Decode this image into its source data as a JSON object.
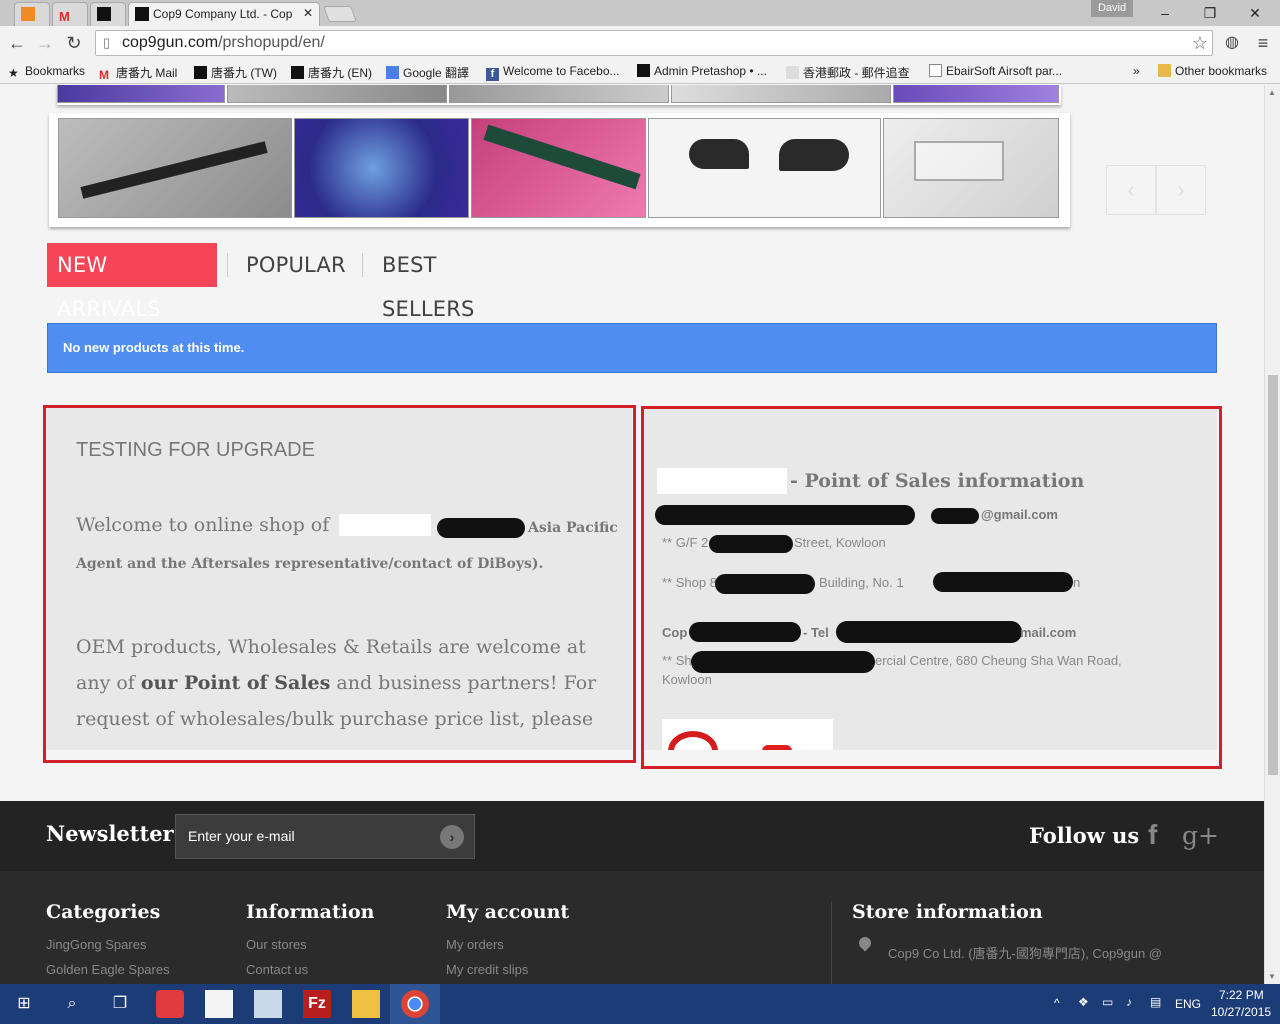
{
  "browser": {
    "tabs": [
      {
        "label": ""
      },
      {
        "label": ""
      },
      {
        "label": ""
      },
      {
        "label": "Cop9 Company Ltd. - Cop"
      }
    ],
    "user": "David",
    "url_host": "cop9gun.com",
    "url_path": "/prshopupd/en/",
    "bookmarks": [
      "Bookmarks",
      "唐番九 Mail",
      "唐番九 (TW)",
      "唐番九 (EN)",
      "Google 翻譯",
      "Welcome to Facebo...",
      "Admin Pretashop • ...",
      "香港郵政 - 郵件追查",
      "EbairSoft Airsoft par...",
      "»",
      "Other bookmarks"
    ]
  },
  "product_tabs": {
    "new_arrivals": "NEW ARRIVALS",
    "popular": "POPULAR",
    "best_sellers": "BEST SELLERS"
  },
  "alert": "No new products at this time.",
  "left_panel": {
    "heading": "TESTING FOR UPGRADE",
    "welcome_prefix": "Welcome to online shop of",
    "welcome_suffix": "Asia Pacific",
    "agent_line": "Agent and the Aftersales representative/contact of DiBoys).",
    "oem_line1": "OEM products, Wholesales & Retails are welcome at",
    "oem_line2a": "any of",
    "oem_bold": "our Point of Sales",
    "oem_line2b": "and business partners! For",
    "oem_line3": "request of wholesales/bulk purchase price list, please"
  },
  "right_panel": {
    "title": "- Point of Sales information",
    "line1_end": "@gmail.com",
    "line2_start": "** G/F 2",
    "line2_end": "Street, Kowloon",
    "line3_start": "** Shop 8",
    "line3_mid": "Building, No. 1",
    "line3_end": "n",
    "line4_start": "Cop",
    "line4_mid": "- Tel",
    "line4_end": "mail.com",
    "line5_start": "** Sh",
    "line5_end": "ercial Centre, 680 Cheung Sha Wan Road,",
    "line6": "Kowloon"
  },
  "footer": {
    "newsletter_title": "Newsletter",
    "email_placeholder": "Enter your e-mail",
    "follow_title": "Follow us",
    "categories_title": "Categories",
    "categories_item": "JingGong Spares",
    "categories_item2": "Golden Eagle Spares",
    "information_title": "Information",
    "information_item": "Our stores",
    "information_item2": "Contact us",
    "account_title": "My account",
    "account_item": "My orders",
    "account_item2": "My credit slips",
    "store_title": "Store information",
    "store_line": "Cop9 Co Ltd. (唐番九-國狗專門店), Cop9gun @"
  },
  "taskbar": {
    "lang": "ENG",
    "time": "7:22 PM",
    "date": "10/27/2015"
  },
  "colors": {
    "accent_red": "#f54556",
    "alert_blue": "#4f8ef0",
    "highlight_box": "#d12027",
    "taskbar": "#1c3c78"
  }
}
